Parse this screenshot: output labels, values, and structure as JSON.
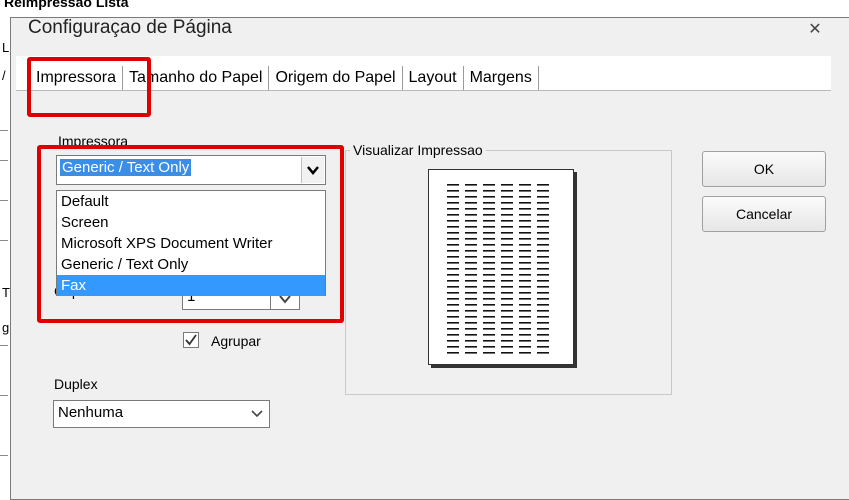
{
  "background": {
    "top_text": "Reimpressão Lista",
    "marks": [
      "L",
      "/",
      "T",
      "g"
    ]
  },
  "dialog": {
    "title": "Configuraçao de Página",
    "close_glyph": "✕"
  },
  "tabs": [
    "Impressora",
    "Tamanho do Papel",
    "Origem do Papel",
    "Layout",
    "Margens"
  ],
  "printer": {
    "label": "Impressora",
    "selected": "Generic / Text Only",
    "options": [
      "Default",
      "Screen",
      "Microsoft XPS Document Writer",
      "Generic / Text Only",
      "Fax"
    ],
    "highlighted": "Fax"
  },
  "copies": {
    "label": "Cópias",
    "value": "1"
  },
  "collate": {
    "label": "Agrupar",
    "checked": true
  },
  "duplex": {
    "label": "Duplex",
    "value": "Nenhuma"
  },
  "preview": {
    "label": "Visualizar Impressao"
  },
  "buttons": {
    "ok": "OK",
    "cancel": "Cancelar"
  },
  "colors": {
    "highlight_red": "#e00000",
    "selection_blue": "#3399ff",
    "dialog_bg": "#f0f0f0"
  }
}
